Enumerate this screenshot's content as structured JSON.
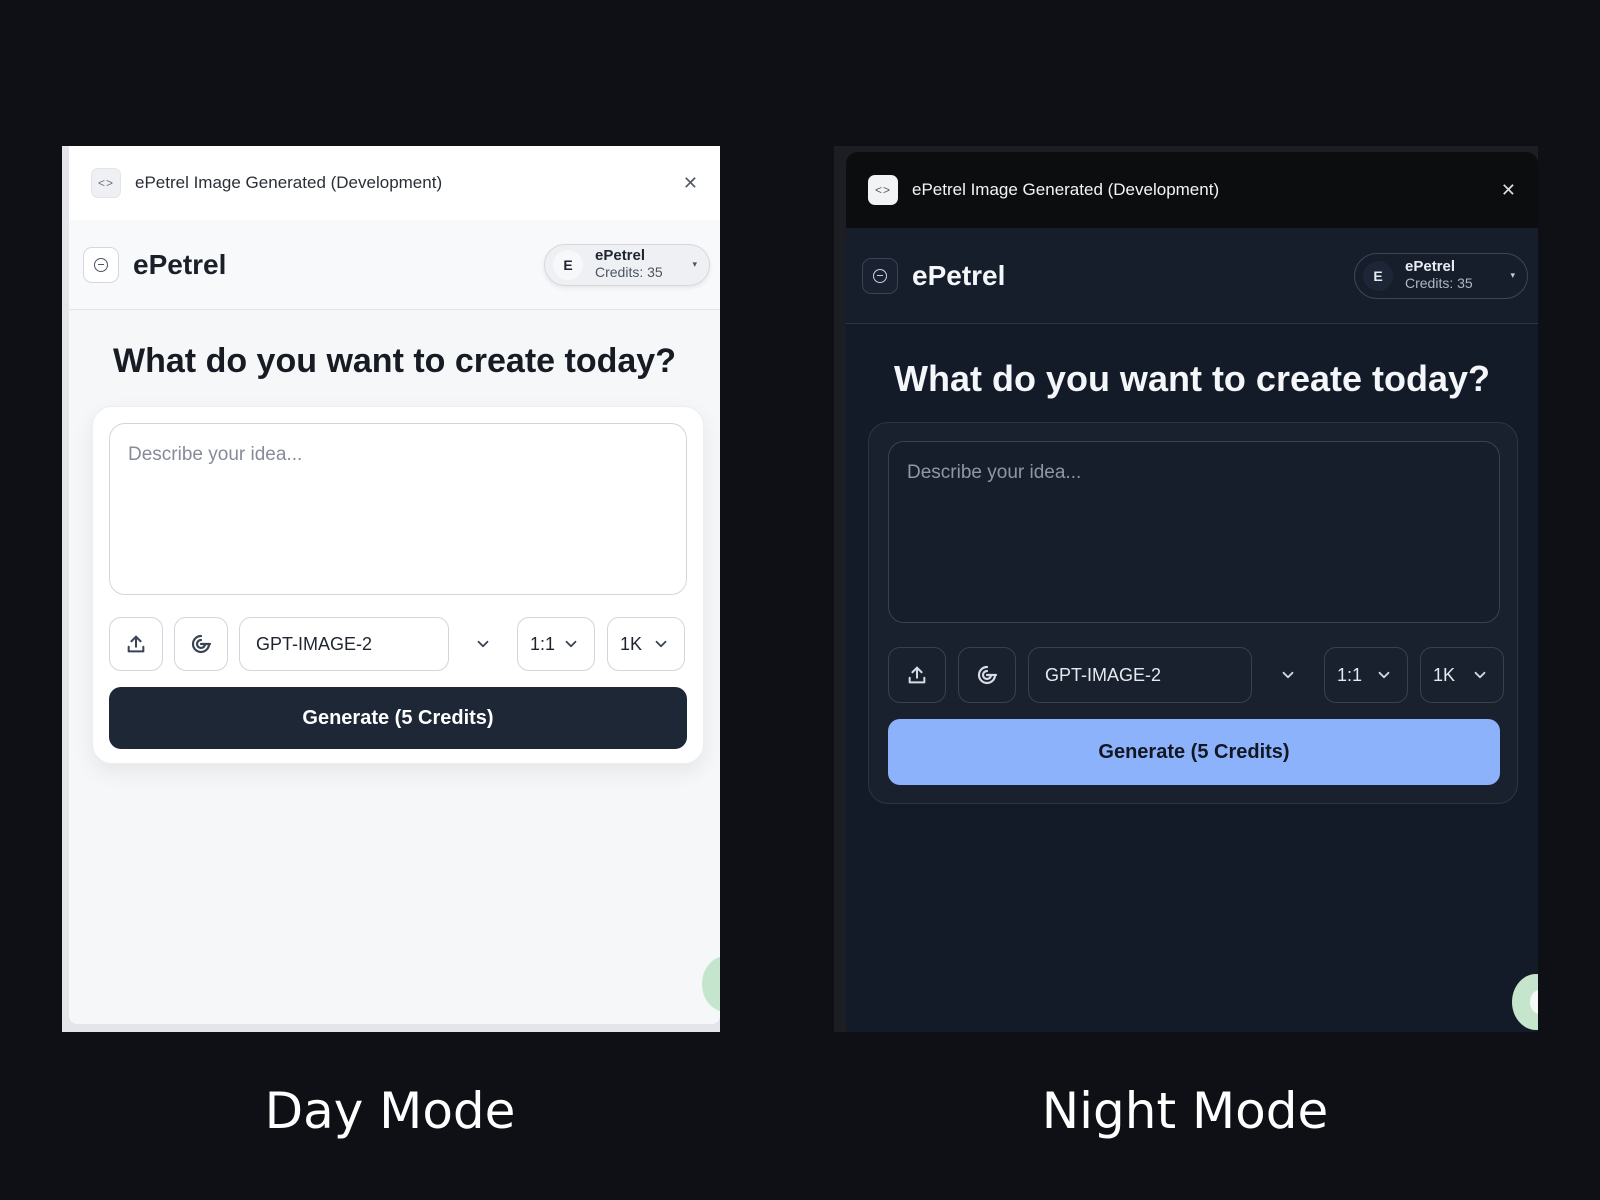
{
  "day": {
    "window_title": "ePetrel Image Generated (Development)",
    "close_glyph": "✕",
    "brand": "ePetrel",
    "account": {
      "avatar": "E",
      "name": "ePetrel",
      "credits": "Credits: 35",
      "caret": "▾"
    },
    "headline": "What do you want to create today?",
    "prompt_placeholder": "Describe your idea...",
    "model": "GPT-IMAGE-2",
    "aspect": "1:1",
    "resolution": "1K",
    "generate_label": "Generate (5 Credits)"
  },
  "night": {
    "window_title": "ePetrel Image Generated (Development)",
    "close_glyph": "✕",
    "brand": "ePetrel",
    "account": {
      "avatar": "E",
      "name": "ePetrel",
      "credits": "Credits: 35",
      "caret": "▾"
    },
    "headline": "What do you want to create today?",
    "prompt_placeholder": "Describe your idea...",
    "model": "GPT-IMAGE-2",
    "aspect": "1:1",
    "resolution": "1K",
    "generate_label": "Generate (5 Credits)"
  },
  "captions": {
    "day": "Day Mode",
    "night": "Night Mode"
  },
  "icons": {
    "code": "code-icon",
    "minimize": "minus-circle-icon",
    "upload": "upload-icon",
    "style": "swirl-icon",
    "chevron": "chevron-down-icon",
    "close": "close-icon"
  },
  "colors": {
    "day_generate_bg": "#1d2736",
    "night_generate_bg": "#8cb2fb",
    "night_window_bg": "#141b28",
    "page_bg": "#0e1016"
  }
}
